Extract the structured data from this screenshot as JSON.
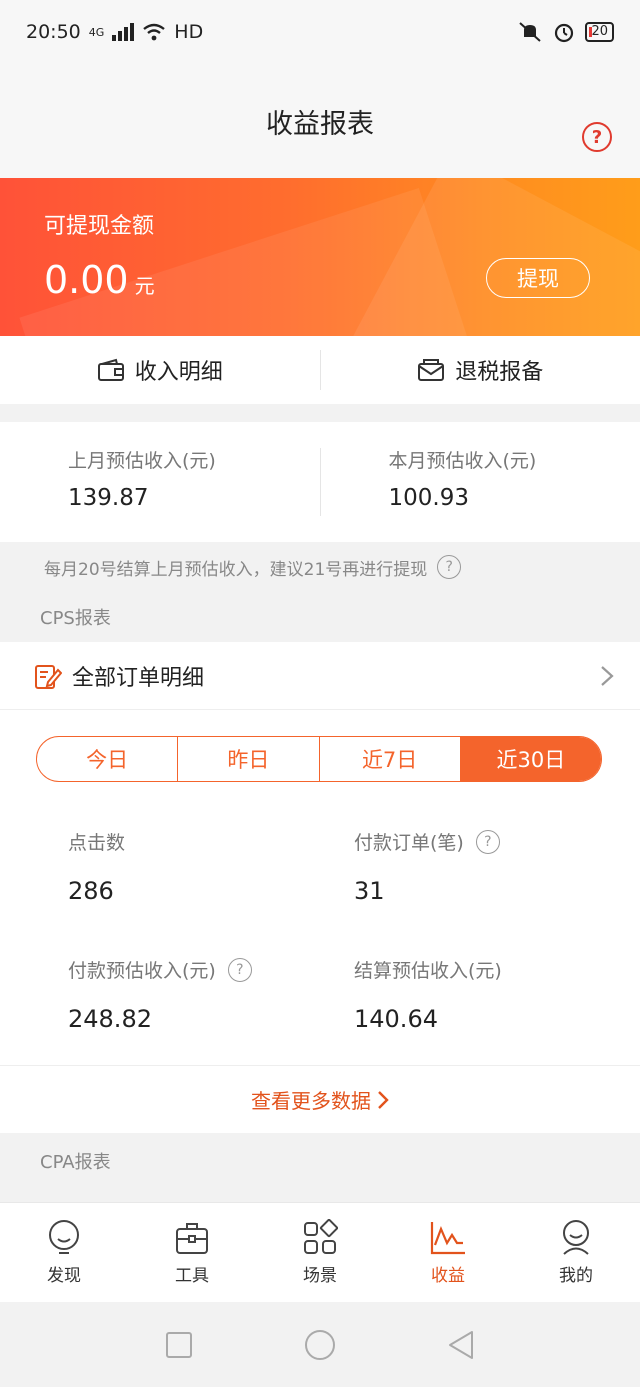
{
  "status_bar": {
    "time": "20:50",
    "network": "4G",
    "hd": "HD",
    "battery": "20"
  },
  "header": {
    "title": "收益报表",
    "help": "?"
  },
  "balance": {
    "label": "可提现金额",
    "amount": "0.00",
    "unit": "元",
    "withdraw_label": "提现"
  },
  "quick_links": [
    {
      "label": "收入明细"
    },
    {
      "label": "退税报备"
    }
  ],
  "estimates": [
    {
      "label": "上月预估收入(元)",
      "value": "139.87"
    },
    {
      "label": "本月预估收入(元)",
      "value": "100.93"
    }
  ],
  "notice": {
    "text": "每月20号结算上月预估收入，建议21号再进行提现",
    "help": "?"
  },
  "cps": {
    "section_title": "CPS报表",
    "orders_label": "全部订单明细",
    "periods": [
      "今日",
      "昨日",
      "近7日",
      "近30日"
    ],
    "active_period": "近30日",
    "stats": [
      {
        "label": "点击数",
        "value": "286"
      },
      {
        "label": "付款订单(笔)",
        "value": "31",
        "help": "?"
      },
      {
        "label": "付款预估收入(元)",
        "value": "248.82",
        "help": "?"
      },
      {
        "label": "结算预估收入(元)",
        "value": "140.64"
      }
    ],
    "more_label": "查看更多数据"
  },
  "cpa": {
    "section_title": "CPA报表"
  },
  "tabs": [
    {
      "label": "发现",
      "icon": "bulb-icon"
    },
    {
      "label": "工具",
      "icon": "toolbox-icon"
    },
    {
      "label": "场景",
      "icon": "grid-icon"
    },
    {
      "label": "收益",
      "icon": "chart-icon",
      "active": true
    },
    {
      "label": "我的",
      "icon": "user-icon"
    }
  ],
  "colors": {
    "accent": "#f4642c",
    "banner_start": "#ff5238",
    "banner_end": "#ff9d1a"
  }
}
